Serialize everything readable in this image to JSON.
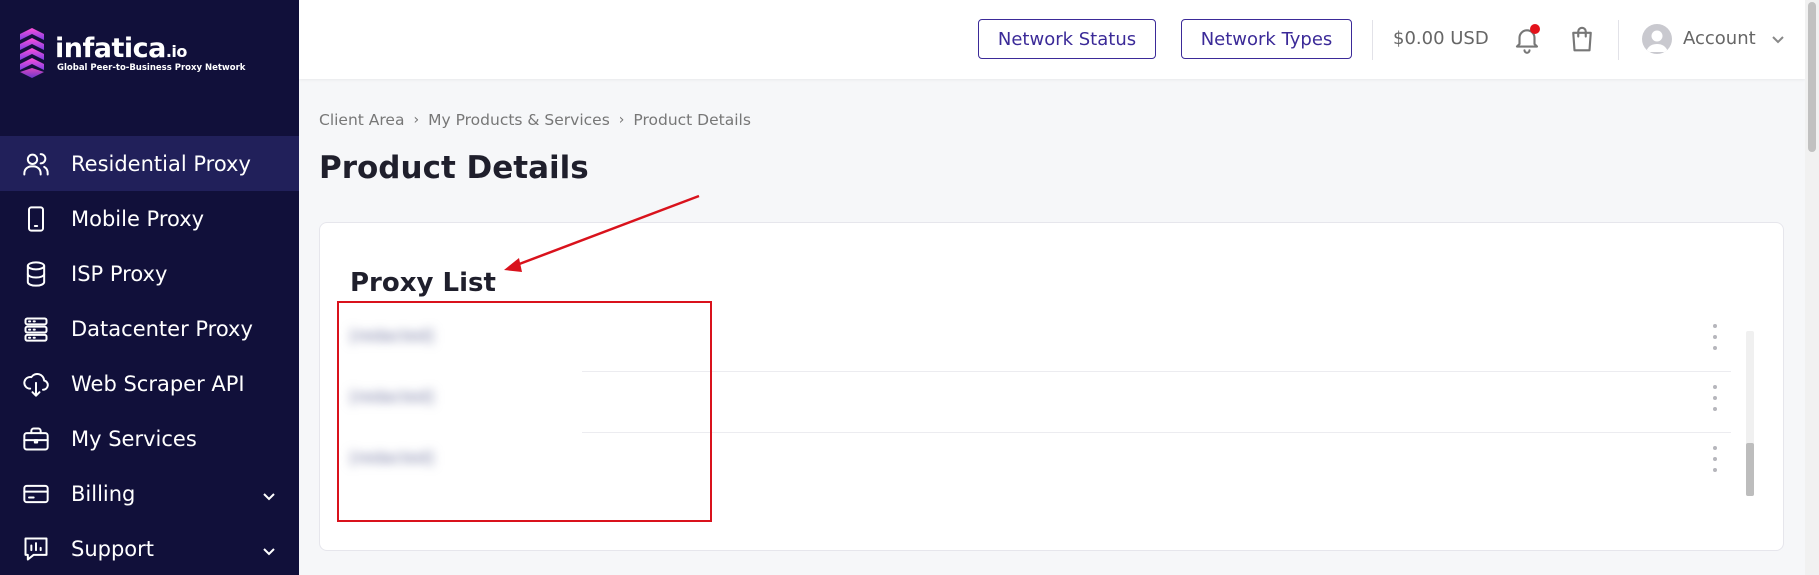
{
  "brand": {
    "name": "infatica",
    "suffix": ".io",
    "tagline": "Global Peer-to-Business Proxy Network",
    "colors": {
      "sidebar": "#11103a",
      "sidebar_active": "#21205a",
      "accent": "#3b2a98",
      "logo_gradient": [
        "#ff4fd8",
        "#7b3fe4"
      ]
    }
  },
  "sidebar": {
    "items": [
      {
        "label": "Residential Proxy",
        "icon": "users-icon",
        "active": true
      },
      {
        "label": "Mobile Proxy",
        "icon": "smartphone-icon"
      },
      {
        "label": "ISP Proxy",
        "icon": "database-icon"
      },
      {
        "label": "Datacenter Proxy",
        "icon": "server-icon"
      },
      {
        "label": "Web Scraper API",
        "icon": "cloud-download-icon"
      },
      {
        "label": "My Services",
        "icon": "briefcase-icon"
      },
      {
        "label": "Billing",
        "icon": "credit-card-icon",
        "expandable": true
      },
      {
        "label": "Support",
        "icon": "chart-chat-icon",
        "expandable": true
      }
    ]
  },
  "header": {
    "network_status": "Network Status",
    "network_types": "Network Types",
    "balance": "$0.00 USD",
    "account": "Account",
    "notification_dot_color": "#e3121b"
  },
  "breadcrumb": [
    "Client Area",
    "My Products & Services",
    "Product Details"
  ],
  "page_title": "Product Details",
  "proxy_list": {
    "title": "Proxy List",
    "rows": [
      "[redacted]",
      "[redacted]",
      "[redacted]"
    ]
  },
  "annotation": {
    "color": "#d9121c"
  }
}
